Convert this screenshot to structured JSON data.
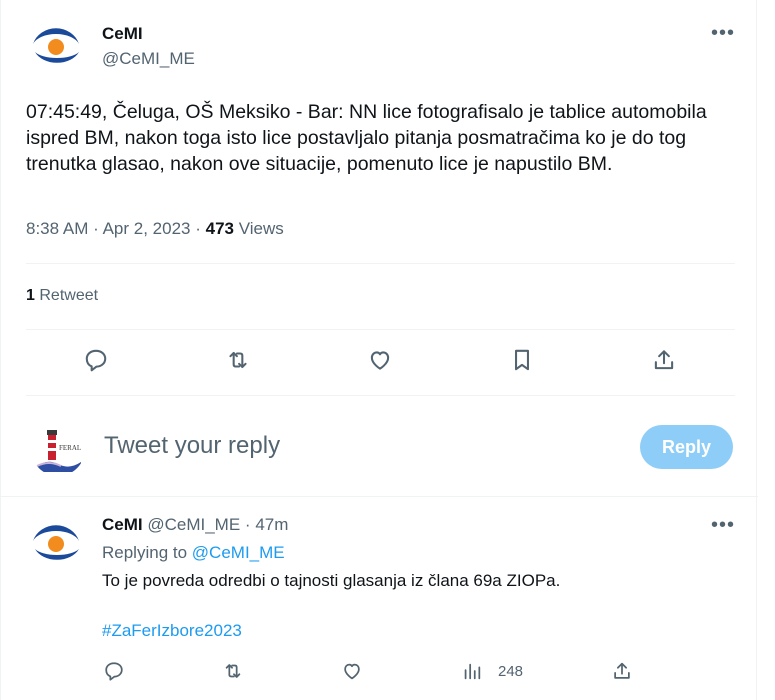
{
  "tweet": {
    "author_name": "CeMI",
    "author_handle": "@CeMI_ME",
    "more_label": "•••",
    "text": "07:45:49, Čeluga, OŠ Meksiko - Bar: NN lice fotografisalo je tablice automobila ispred BM, nakon toga isto lice postavljalo pitanja posmatračima ko je do tog trenutka glasao, nakon ove situacije, pomenuto lice je napustilo BM.",
    "time": "8:38 AM",
    "date": "Apr 2, 2023",
    "sep": "·",
    "views_count": "473",
    "views_label": "Views",
    "retweet_count": "1",
    "retweet_label": "Retweet",
    "actions": [
      "reply-icon",
      "retweet-icon",
      "like-icon",
      "bookmark-icon",
      "share-icon"
    ]
  },
  "composer": {
    "avatar_label": "FERAL",
    "placeholder": "Tweet your reply",
    "button_label": "Reply"
  },
  "reply": {
    "author_name": "CeMI",
    "author_handle": "@CeMI_ME",
    "sep": "·",
    "time_ago": "47m",
    "more_label": "•••",
    "replying_prefix": "Replying to",
    "replying_handle": "@CeMI_ME",
    "text": "To je povreda odredbi o tajnosti glasanja iz člana 69a ZIOPa.",
    "hashtag": "#ZaFerIzbore2023",
    "views_count": "248",
    "actions": [
      "reply-icon",
      "retweet-icon",
      "like-icon",
      "views-icon",
      "share-icon"
    ]
  },
  "colors": {
    "brand_blue": "#1b4a9b",
    "brand_orange": "#f28c1f",
    "link": "#1d9bf0",
    "reply_button": "#8ecdf7",
    "muted": "#536471"
  }
}
